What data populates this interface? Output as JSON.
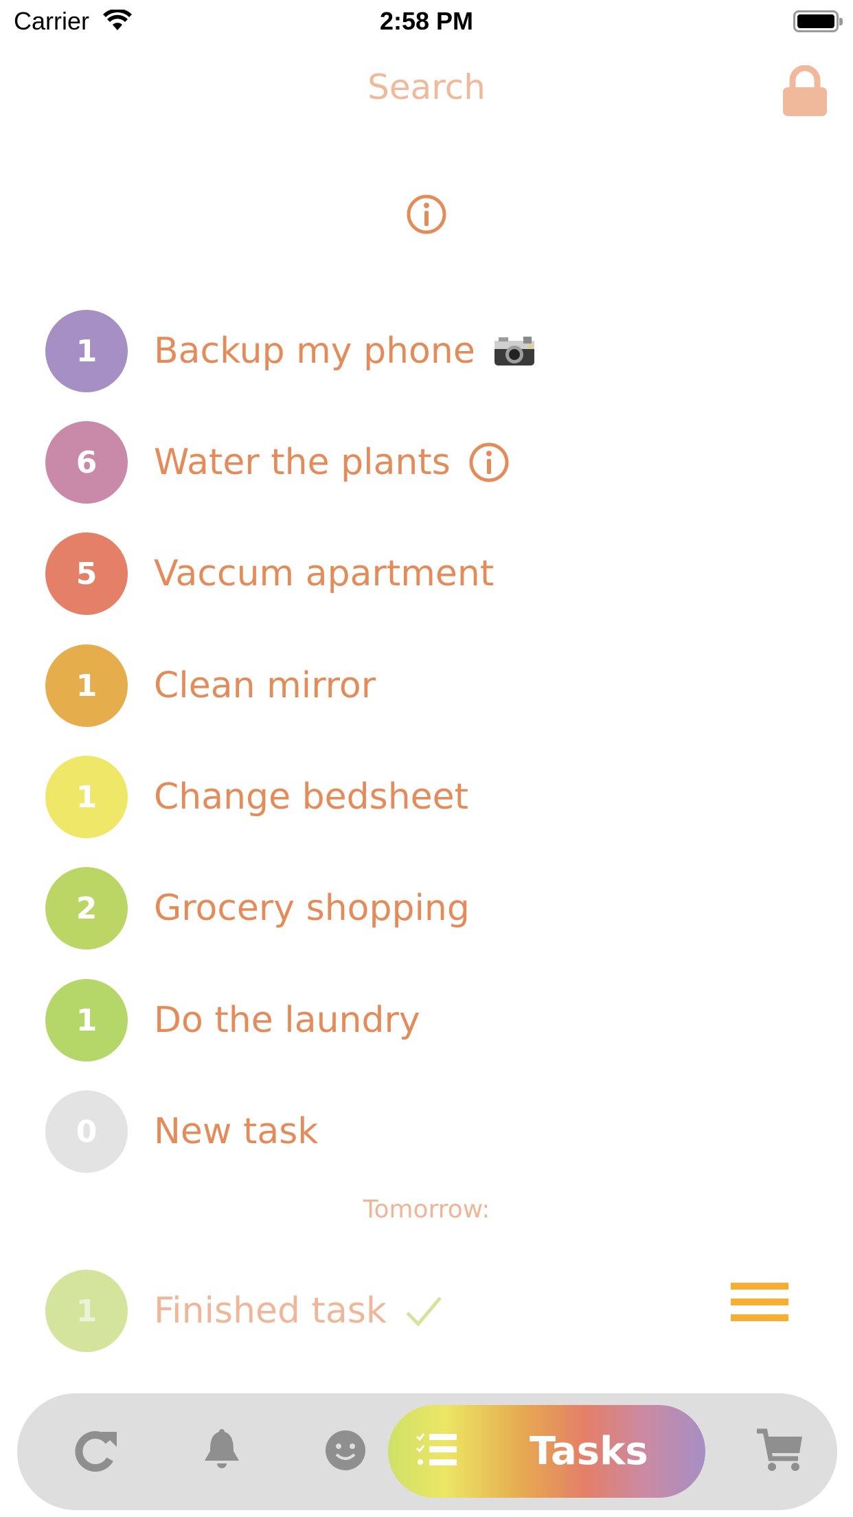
{
  "status_bar": {
    "carrier": "Carrier",
    "time": "2:58 PM",
    "wifi_icon": "wifi-icon",
    "battery_icon": "battery-icon"
  },
  "header": {
    "title": "Search",
    "lock_icon": "lock-icon",
    "info_icon": "info-icon"
  },
  "colors": {
    "accent": "#e48b5a",
    "accent_light": "#f0b99b",
    "menu": "#f7ae32",
    "tabbar_bg": "#dedede",
    "tab_icon": "#8f8f8f"
  },
  "tasks": [
    {
      "count": "1",
      "title": "Backup my phone",
      "color": "#a68fc3",
      "trailing": "camera-icon"
    },
    {
      "count": "6",
      "title": "Water the plants",
      "color": "#c98aa9",
      "trailing": "info-icon"
    },
    {
      "count": "5",
      "title": "Vaccum apartment",
      "color": "#e47f68",
      "trailing": null
    },
    {
      "count": "1",
      "title": "Clean mirror",
      "color": "#e6ad4d",
      "trailing": null
    },
    {
      "count": "1",
      "title": "Change bedsheet",
      "color": "#efe767",
      "trailing": null
    },
    {
      "count": "2",
      "title": "Grocery shopping",
      "color": "#bcd665",
      "trailing": null
    },
    {
      "count": "1",
      "title": "Do the laundry",
      "color": "#b5d668",
      "trailing": null
    },
    {
      "count": "0",
      "title": "New task",
      "color": "#e3e3e3",
      "trailing": null
    }
  ],
  "section_label": "Tomorrow:",
  "finished": [
    {
      "count": "1",
      "title": "Finished task",
      "color": "#d4e49c",
      "trailing": "checkmark-icon"
    }
  ],
  "tabbar": {
    "tabs": [
      {
        "name": "refresh",
        "icon": "refresh-icon"
      },
      {
        "name": "notifications",
        "icon": "bell-icon"
      },
      {
        "name": "mood",
        "icon": "smiley-icon"
      },
      {
        "name": "tasks",
        "icon": "checklist-icon",
        "label": "Tasks",
        "selected": true
      },
      {
        "name": "shopping",
        "icon": "cart-icon"
      }
    ]
  }
}
